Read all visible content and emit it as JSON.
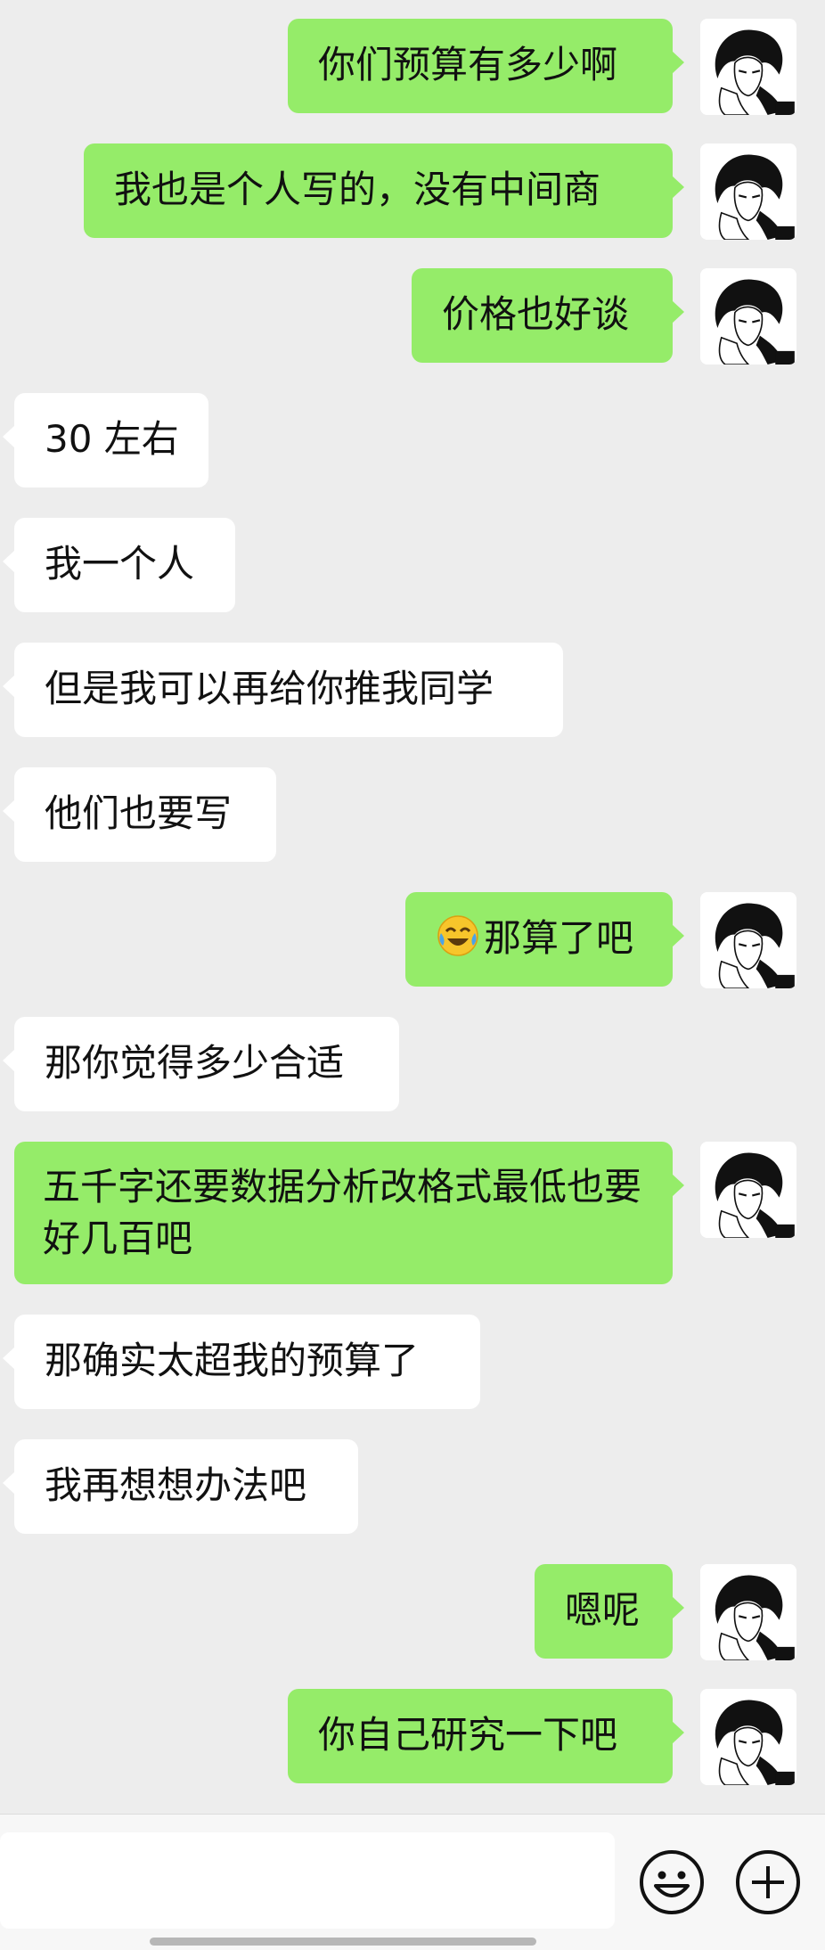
{
  "messages": [
    {
      "side": "out",
      "text": "你们预算有多少啊"
    },
    {
      "side": "out",
      "text": "我也是个人写的，没有中间商"
    },
    {
      "side": "out",
      "text": "价格也好谈"
    },
    {
      "side": "in",
      "text": "30 左右"
    },
    {
      "side": "in",
      "text": "我一个人"
    },
    {
      "side": "in",
      "text": "但是我可以再给你推我同学"
    },
    {
      "side": "in",
      "text": "他们也要写"
    },
    {
      "side": "out",
      "text": "那算了吧",
      "emoji": "face-with-tears-of-joy-icon"
    },
    {
      "side": "in",
      "text": "那你觉得多少合适"
    },
    {
      "side": "out",
      "text": "五千字还要数据分析改格式最低也要好几百吧"
    },
    {
      "side": "in",
      "text": "那确实太超我的预算了"
    },
    {
      "side": "in",
      "text": "我再想想办法吧"
    },
    {
      "side": "out",
      "text": "嗯呢"
    },
    {
      "side": "out",
      "text": "你自己研究一下吧"
    }
  ],
  "input_bar": {
    "message_input_value": "",
    "emoji_button_icon": "smiley-face-icon",
    "more_button_icon": "plus-circle-icon"
  },
  "colors": {
    "background": "#ededed",
    "outgoing_bubble": "#95ec69",
    "incoming_bubble": "#ffffff"
  }
}
